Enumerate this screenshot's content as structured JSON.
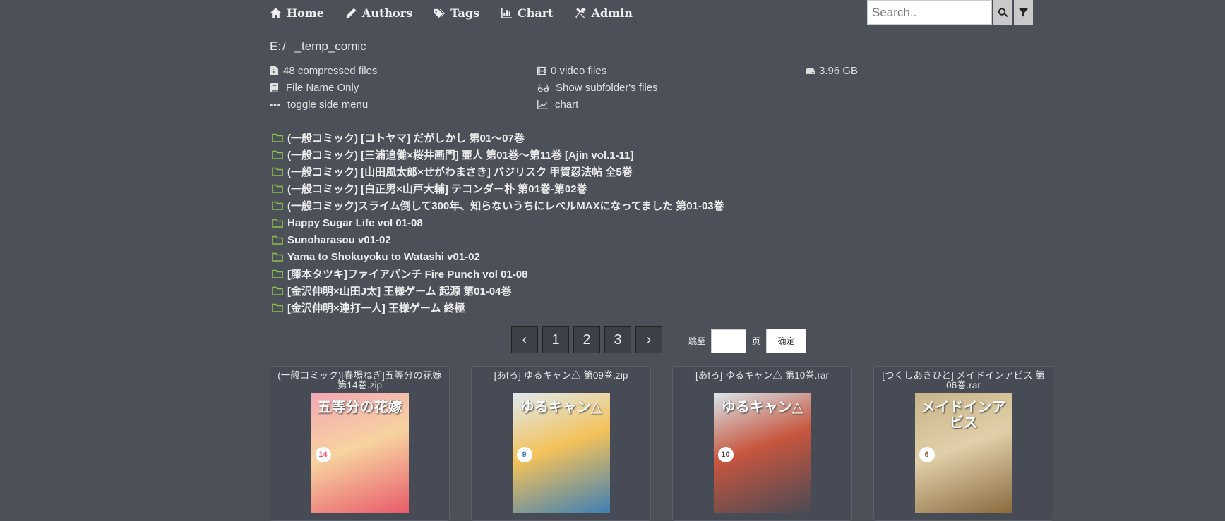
{
  "nav": {
    "home": "Home",
    "authors": "Authors",
    "tags": "Tags",
    "chart": "Chart",
    "admin": "Admin"
  },
  "search": {
    "placeholder": "Search.."
  },
  "path": {
    "drive": "E:",
    "sep": "/",
    "folder": "_temp_comic"
  },
  "info": {
    "compressed": "48 compressed files",
    "video": "0 video files",
    "size": "3.96 GB",
    "file_name_only": "File Name Only",
    "show_subfolder": "Show subfolder's files",
    "toggle_menu": "toggle side menu",
    "chart": "chart"
  },
  "folders": [
    "(一般コミック) [コトヤマ] だがしかし 第01～07巻",
    "(一般コミック) [三浦追儺×桜井画門] 亜人 第01巻～第11巻 [Ajin vol.1-11]",
    "(一般コミック) [山田風太郎×せがわまさき] バジリスク 甲賀忍法帖 全5巻",
    "(一般コミック) [白正男×山戸大輔] テコンダー朴 第01巻-第02巻",
    "(一般コミック)スライム倒して300年、知らないうちにレベルMAXになってました 第01-03巻",
    "Happy Sugar Life vol 01-08",
    "Sunoharasou v01-02",
    "Yama to Shokuyoku to Watashi v01-02",
    "[藤本タツキ]ファイアパンチ Fire Punch vol 01-08",
    "[金沢伸明×山田J太] 王様ゲーム 起源 第01-04巻",
    "[金沢伸明×連打一人] 王様ゲーム 終極"
  ],
  "pagination": {
    "prev": "‹",
    "pages": [
      "1",
      "2",
      "3"
    ],
    "next": "›"
  },
  "jump": {
    "label_before": "跳至",
    "label_after": "页",
    "confirm": "确定"
  },
  "cards": [
    {
      "title": "(一般コミック)[春場ねぎ]五等分の花嫁 第14巻.zip",
      "cover_text": "五等分の花嫁",
      "vol": "14",
      "colors": [
        "#f2a7b5",
        "#e85a6a",
        "#f7d3a0"
      ]
    },
    {
      "title": "[あfろ] ゆるキャン△ 第09巻.zip",
      "cover_text": "ゆるキャン△",
      "vol": "9",
      "colors": [
        "#dfe9ef",
        "#3d7fb5",
        "#f3c25a"
      ]
    },
    {
      "title": "[あfろ] ゆるキャン△ 第10巻.rar",
      "cover_text": "ゆるキャン△",
      "vol": "10",
      "colors": [
        "#d8e4ea",
        "#4a4a55",
        "#c7563e"
      ]
    },
    {
      "title": "[つくしあきひと] メイドインアビス 第06巻.rar",
      "cover_text": "メイドインアビス",
      "vol": "6",
      "colors": [
        "#c9b48a",
        "#8a6a3e",
        "#e0cfa8"
      ]
    }
  ]
}
